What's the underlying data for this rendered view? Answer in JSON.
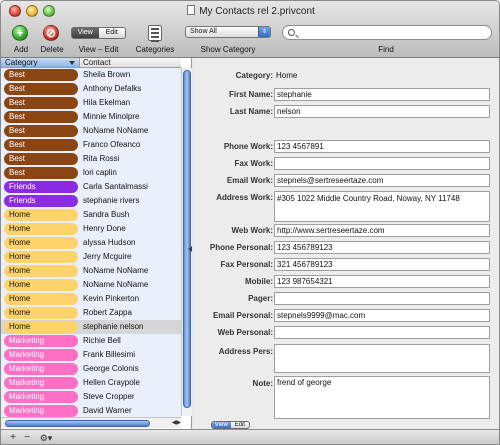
{
  "window": {
    "title": "My Contacts rel 2.privcont"
  },
  "toolbar": {
    "add_label": "Add",
    "delete_label": "Delete",
    "view_seg": [
      "View",
      "Edit"
    ],
    "view_edit_label": "View – Edit",
    "categories_label": "Categories",
    "show_category_value": "Show All",
    "show_category_label": "Show Category",
    "search_placeholder": "",
    "find_label": "Find"
  },
  "list": {
    "headers": {
      "category": "Category",
      "contact": "Contact"
    },
    "rows": [
      {
        "category": "Best",
        "name": "Sheila Brown"
      },
      {
        "category": "Best",
        "name": "Anthony Defalks"
      },
      {
        "category": "Best",
        "name": "Hila Ekelman"
      },
      {
        "category": "Best",
        "name": "Minnie Minolpre"
      },
      {
        "category": "Best",
        "name": "NoName NoName"
      },
      {
        "category": "Best",
        "name": "Franco Ofeanco"
      },
      {
        "category": "Best",
        "name": "Rita Rossi"
      },
      {
        "category": "Best",
        "name": "lori caplin"
      },
      {
        "category": "Friends",
        "name": "Carla Santalmassi"
      },
      {
        "category": "Friends",
        "name": "stephanie rivers"
      },
      {
        "category": "Home",
        "name": "Sandra Bush"
      },
      {
        "category": "Home",
        "name": "Henry Done"
      },
      {
        "category": "Home",
        "name": "alyssa Hudson"
      },
      {
        "category": "Home",
        "name": "Jerry Mcguire"
      },
      {
        "category": "Home",
        "name": "NoName NoName"
      },
      {
        "category": "Home",
        "name": "NoName NoName"
      },
      {
        "category": "Home",
        "name": "Kevin Pinkerton"
      },
      {
        "category": "Home",
        "name": "Robert Zappa"
      },
      {
        "category": "Home",
        "name": "stephanie nelson",
        "selected": true
      },
      {
        "category": "Marketing",
        "name": "Richie Bell"
      },
      {
        "category": "Marketing",
        "name": "Frank Billesimi"
      },
      {
        "category": "Marketing",
        "name": "George Colonis"
      },
      {
        "category": "Marketing",
        "name": "Hellen Craypole"
      },
      {
        "category": "Marketing",
        "name": "Steve Cropper"
      },
      {
        "category": "Marketing",
        "name": "David Warner"
      }
    ],
    "category_colors": {
      "Best": "#8b4513",
      "Friends": "#8b2be2",
      "Home": "#ffd36b",
      "Marketing": "#ff6fc4"
    }
  },
  "detail": {
    "category": {
      "label": "Category:",
      "value": "Home"
    },
    "first_name": {
      "label": "First Name:",
      "value": "stephanie"
    },
    "last_name": {
      "label": "Last Name:",
      "value": "nelson"
    },
    "phone_work": {
      "label": "Phone Work:",
      "value": "123 4567891"
    },
    "fax_work": {
      "label": "Fax Work:",
      "value": ""
    },
    "email_work": {
      "label": "Email Work:",
      "value": "stepnels@sertreseertaze.com"
    },
    "address_work": {
      "label": "Address Work:",
      "value": "#305 1022 Middle Country Road, Noway, NY 11748"
    },
    "web_work": {
      "label": "Web Work:",
      "value": "http://www.sertreseertaze.com"
    },
    "phone_personal": {
      "label": "Phone Personal:",
      "value": "123 456789123"
    },
    "fax_personal": {
      "label": "Fax Personal:",
      "value": "321 456789123"
    },
    "mobile": {
      "label": "Mobile:",
      "value": "123 987654321"
    },
    "pager": {
      "label": "Pager:",
      "value": ""
    },
    "email_personal": {
      "label": "Email Personal:",
      "value": "stepnels9999@mac.com"
    },
    "web_personal": {
      "label": "Web Personal:",
      "value": ""
    },
    "address_pers": {
      "label": "Address Pers:",
      "value": ""
    },
    "note": {
      "label": "Note:",
      "value": "frend of george"
    },
    "view_seg": [
      "View",
      "Edit"
    ]
  },
  "bottombar": {
    "add": "+",
    "remove": "−",
    "action": "⚙▾"
  }
}
